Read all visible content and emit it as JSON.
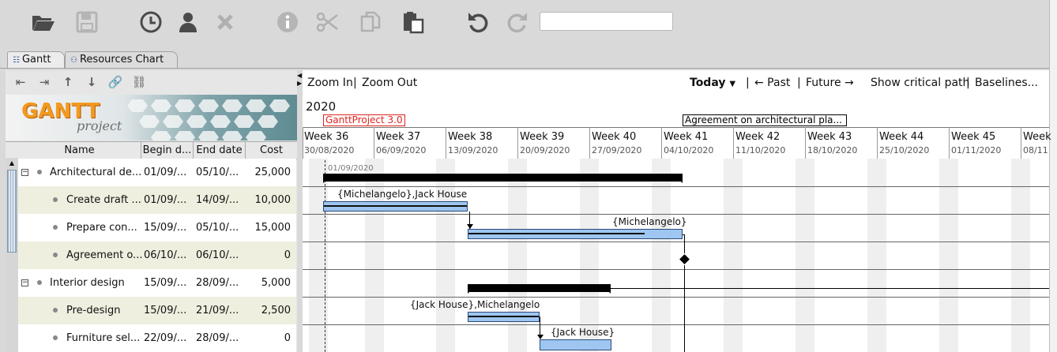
{
  "toolbar": {
    "icons": [
      "open-folder-icon",
      "save-icon",
      "history-icon",
      "user-icon",
      "delete-icon",
      "info-icon",
      "cut-icon",
      "copy-icon",
      "paste-icon",
      "undo-icon",
      "redo-icon"
    ],
    "search_value": ""
  },
  "tabs": [
    {
      "label": "Gantt",
      "active": true
    },
    {
      "label": "Resources Chart",
      "active": false
    }
  ],
  "task_toolbar": {
    "icons": [
      "outdent-icon",
      "indent-icon",
      "move-up-icon",
      "move-down-icon",
      "link-icon",
      "unlink-icon"
    ]
  },
  "logo": {
    "brand": "GANTT",
    "sub": "project"
  },
  "columns": [
    "Name",
    "Begin d...",
    "End date",
    "Cost"
  ],
  "rows": [
    {
      "name": "Architectural de...",
      "begin": "01/09/...",
      "end": "05/10/...",
      "cost": "25,000",
      "level": 0,
      "expand": "−"
    },
    {
      "name": "Create draft ...",
      "begin": "01/09/...",
      "end": "14/09/...",
      "cost": "10,000",
      "level": 1
    },
    {
      "name": "Prepare con...",
      "begin": "15/09/...",
      "end": "05/10/...",
      "cost": "15,000",
      "level": 1
    },
    {
      "name": "Agreement o...",
      "begin": "06/10/...",
      "end": "06/10/...",
      "cost": "0",
      "level": 1
    },
    {
      "name": "Interior design",
      "begin": "15/09/...",
      "end": "28/09/...",
      "cost": "5,000",
      "level": 0,
      "expand": "−"
    },
    {
      "name": "Pre-design",
      "begin": "15/09/...",
      "end": "21/09/...",
      "cost": "2,500",
      "level": 1
    },
    {
      "name": "Furniture sel...",
      "begin": "22/09/...",
      "end": "28/09/...",
      "cost": "0",
      "level": 1
    }
  ],
  "chart_toolbar": {
    "zoom_in": "Zoom In",
    "sep": "|",
    "zoom_out": "Zoom Out",
    "today": "Today",
    "past": "← Past",
    "future": "Future →",
    "critical": "Show critical path",
    "baselines": "Baselines..."
  },
  "timeline": {
    "year": "2020",
    "marker_project": "GanttProject 3.0",
    "marker_agreement": "Agreement on architectural pla...",
    "weeks": [
      {
        "label": "Week 36",
        "date": "30/08/2020"
      },
      {
        "label": "Week 37",
        "date": "06/09/2020"
      },
      {
        "label": "Week 38",
        "date": "13/09/2020"
      },
      {
        "label": "Week 39",
        "date": "20/09/2020"
      },
      {
        "label": "Week 40",
        "date": "27/09/2020"
      },
      {
        "label": "Week 41",
        "date": "04/10/2020"
      },
      {
        "label": "Week 42",
        "date": "11/10/2020"
      },
      {
        "label": "Week 43",
        "date": "18/10/2020"
      },
      {
        "label": "Week 44",
        "date": "25/10/2020"
      },
      {
        "label": "Week 45",
        "date": "01/11/2020"
      },
      {
        "label": "Week",
        "date": "08/11"
      }
    ],
    "today_label": "01/09/2020"
  },
  "resources": {
    "create_draft": "{Michelangelo},Jack House",
    "prepare": "{Michelangelo}",
    "pre_design": "{Jack House},Michelangelo",
    "furniture": "{Jack House}"
  }
}
